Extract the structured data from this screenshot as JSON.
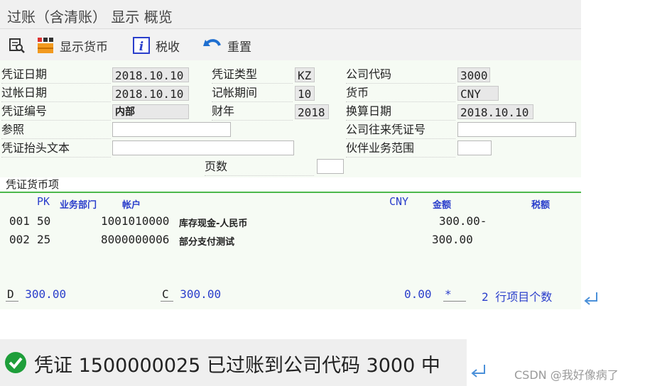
{
  "window": {
    "title": "过账（含清账） 显示 概览"
  },
  "toolbar": {
    "display_currency": "显示货币",
    "tax": "税收",
    "reset": "重置"
  },
  "header": {
    "doc_date_label": "凭证日期",
    "doc_date": "2018.10.10",
    "doc_type_label": "凭证类型",
    "doc_type": "KZ",
    "company_code_label": "公司代码",
    "company_code": "3000",
    "posting_date_label": "过帐日期",
    "posting_date": "2018.10.10",
    "period_label": "记帐期间",
    "period": "10",
    "currency_label": "货币",
    "currency": "CNY",
    "doc_number_label": "凭证编号",
    "doc_number": "内部",
    "fiscal_year_label": "财年",
    "fiscal_year": "2018",
    "translation_date_label": "换算日期",
    "translation_date": "2018.10.10",
    "reference_label": "参照",
    "reference": "",
    "cross_cc_label": "公司往来凭证号",
    "cross_cc": "",
    "header_text_label": "凭证抬头文本",
    "header_text": "",
    "trading_partner_label": "伙伴业务范围",
    "trading_partner": "",
    "pages_label": "页数",
    "pages": ""
  },
  "items_section": {
    "title": "凭证货币项",
    "columns": {
      "pk": "PK",
      "bus_area": "业务部门",
      "account": "帐户",
      "currency": "CNY",
      "amount": "金额",
      "tax": "税额"
    },
    "rows": [
      {
        "no": "001",
        "pk": "50",
        "account": "1001010000",
        "name": "库存现金-人民币",
        "amount": "300.00-"
      },
      {
        "no": "002",
        "pk": "25",
        "account": "8000000006",
        "name": "部分支付测试",
        "amount": "300.00"
      }
    ]
  },
  "totals": {
    "debit_label": "D",
    "debit": "300.00",
    "credit_label": "C",
    "credit": "300.00",
    "balance": "0.00",
    "star": "*",
    "item_count": "2",
    "item_count_label": "行项目个数"
  },
  "status": {
    "message": "凭证 1500000025 已过账到公司代码 3000 中"
  },
  "watermark": "CSDN @我好像病了",
  "colors": {
    "accent_blue": "#2a3ecb",
    "section_green": "#4cb84c",
    "success_green": "#1e9e3a",
    "enter_icon_blue": "#4a90d9"
  }
}
